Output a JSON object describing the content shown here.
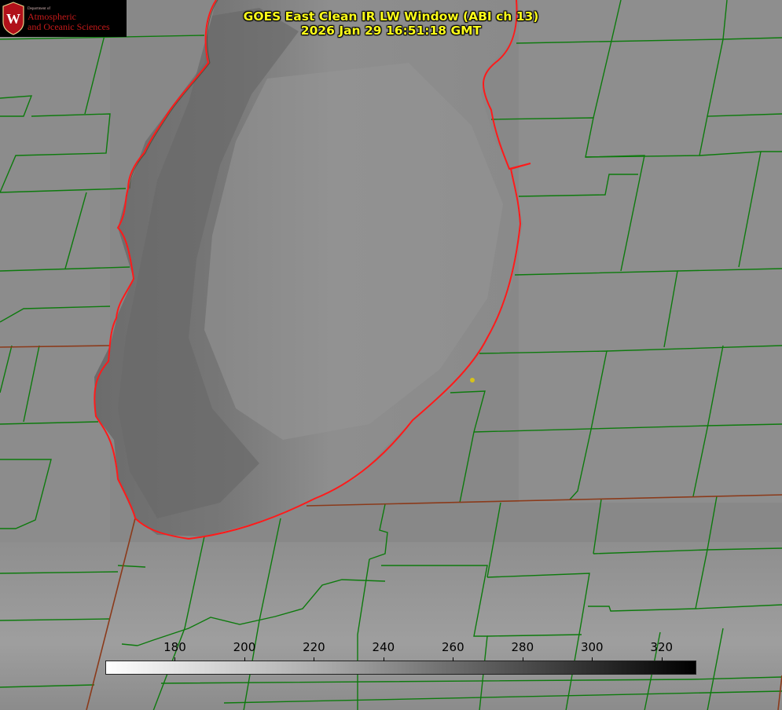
{
  "title": {
    "line1": "GOES East Clean IR LW Window (ABI ch 13)",
    "line2": "2026 Jan 29 16:51:18 GMT"
  },
  "logo": {
    "department": "Department of",
    "line1": "Atmospheric",
    "line2": "and Oceanic Sciences",
    "seal_letter": "W",
    "colors": {
      "background": "#000000",
      "text": "#c51a1a",
      "seal": "#b0101a"
    }
  },
  "colorbar": {
    "unit_note": "",
    "min": 160,
    "max": 330,
    "ticks": [
      180,
      200,
      220,
      240,
      260,
      280,
      300,
      320
    ],
    "colors": {
      "cold": "#ffffff",
      "warm": "#000000"
    }
  },
  "map": {
    "colors": {
      "county_lines": "#0d7a0d",
      "lake_outline": "#ff1a1a",
      "state_lines": "#8b3a1a",
      "marker": "#d6c21a"
    },
    "marker_label": ""
  }
}
